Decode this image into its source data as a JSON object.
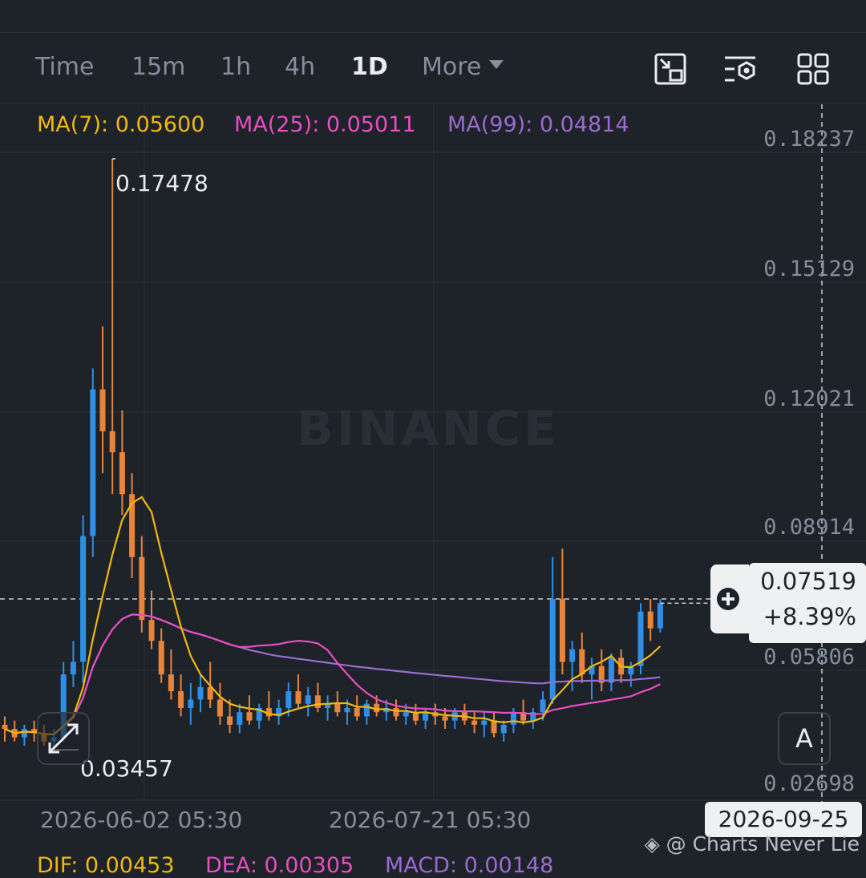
{
  "tabs": [
    {
      "label": "Time",
      "active": false
    },
    {
      "label": "15m",
      "active": false
    },
    {
      "label": "1h",
      "active": false
    },
    {
      "label": "4h",
      "active": false
    },
    {
      "label": "1D",
      "active": true
    },
    {
      "label": "More",
      "active": false
    }
  ],
  "toolbar": {
    "icons": [
      "fullscreen-icon",
      "indicator-settings-icon",
      "layout-grid-icon"
    ]
  },
  "ma": {
    "ma7": {
      "label": "MA(7): 0.05600",
      "color": "#f0b90b"
    },
    "ma25": {
      "label": "MA(25): 0.05011",
      "color": "#e84ec1"
    },
    "ma99": {
      "label": "MA(99): 0.04814",
      "color": "#9b6bd1"
    }
  },
  "y_axis": [
    "0.18237",
    "0.15129",
    "0.12021",
    "0.08914",
    "0.05806",
    "0.02698"
  ],
  "x_axis": [
    "2026-06-02 05:30",
    "2026-07-21 05:30"
  ],
  "high_label": "0.17478",
  "low_label": "0.03457",
  "price_box": {
    "price": "0.07519",
    "change": "+8.39%"
  },
  "crosshair_date": "2026-09-25",
  "auto_button": "A",
  "watermark": "BINANCE",
  "credit": "@ Charts Never Lie",
  "macd": {
    "dif": "DIF: 0.00453",
    "dea": "DEA: 0.00305",
    "macd": "MACD: 0.00148"
  },
  "colors": {
    "up": "#2f8fe8",
    "down": "#e8853a",
    "background": "#1e2229"
  },
  "chart_data": {
    "type": "candlestick",
    "ylim": [
      0.022,
      0.188
    ],
    "up_color": "#2f8fe8",
    "down_color": "#e8853a",
    "ohlc_start_index": 0,
    "candles": [
      [
        0.04,
        0.042,
        0.036,
        0.039
      ],
      [
        0.039,
        0.041,
        0.036,
        0.037
      ],
      [
        0.037,
        0.04,
        0.035,
        0.039
      ],
      [
        0.039,
        0.041,
        0.036,
        0.038
      ],
      [
        0.038,
        0.04,
        0.035,
        0.036
      ],
      [
        0.036,
        0.039,
        0.034,
        0.037
      ],
      [
        0.037,
        0.055,
        0.036,
        0.052
      ],
      [
        0.052,
        0.06,
        0.049,
        0.055
      ],
      [
        0.055,
        0.09,
        0.05,
        0.085
      ],
      [
        0.085,
        0.125,
        0.08,
        0.12
      ],
      [
        0.12,
        0.135,
        0.1,
        0.11
      ],
      [
        0.11,
        0.175,
        0.095,
        0.105
      ],
      [
        0.105,
        0.115,
        0.09,
        0.095
      ],
      [
        0.095,
        0.1,
        0.075,
        0.08
      ],
      [
        0.08,
        0.085,
        0.062,
        0.065
      ],
      [
        0.065,
        0.072,
        0.058,
        0.06
      ],
      [
        0.06,
        0.063,
        0.05,
        0.052
      ],
      [
        0.052,
        0.058,
        0.046,
        0.048
      ],
      [
        0.048,
        0.052,
        0.042,
        0.044
      ],
      [
        0.044,
        0.05,
        0.04,
        0.046
      ],
      [
        0.046,
        0.052,
        0.043,
        0.049
      ],
      [
        0.049,
        0.055,
        0.044,
        0.046
      ],
      [
        0.046,
        0.05,
        0.04,
        0.042
      ],
      [
        0.042,
        0.046,
        0.038,
        0.04
      ],
      [
        0.04,
        0.045,
        0.038,
        0.043
      ],
      [
        0.043,
        0.047,
        0.04,
        0.041
      ],
      [
        0.041,
        0.045,
        0.039,
        0.044
      ],
      [
        0.044,
        0.048,
        0.041,
        0.042
      ],
      [
        0.042,
        0.046,
        0.04,
        0.044
      ],
      [
        0.044,
        0.05,
        0.042,
        0.048
      ],
      [
        0.048,
        0.052,
        0.044,
        0.045
      ],
      [
        0.045,
        0.049,
        0.042,
        0.047
      ],
      [
        0.047,
        0.05,
        0.043,
        0.044
      ],
      [
        0.044,
        0.047,
        0.041,
        0.045
      ],
      [
        0.045,
        0.048,
        0.042,
        0.043
      ],
      [
        0.043,
        0.046,
        0.04,
        0.044
      ],
      [
        0.044,
        0.047,
        0.041,
        0.042
      ],
      [
        0.042,
        0.046,
        0.04,
        0.045
      ],
      [
        0.045,
        0.047,
        0.042,
        0.043
      ],
      [
        0.043,
        0.046,
        0.041,
        0.044
      ],
      [
        0.044,
        0.046,
        0.041,
        0.042
      ],
      [
        0.042,
        0.045,
        0.04,
        0.043
      ],
      [
        0.043,
        0.045,
        0.04,
        0.041
      ],
      [
        0.041,
        0.044,
        0.039,
        0.043
      ],
      [
        0.043,
        0.045,
        0.04,
        0.042
      ],
      [
        0.042,
        0.044,
        0.039,
        0.041
      ],
      [
        0.041,
        0.044,
        0.039,
        0.043
      ],
      [
        0.043,
        0.045,
        0.04,
        0.041
      ],
      [
        0.041,
        0.043,
        0.038,
        0.04
      ],
      [
        0.04,
        0.043,
        0.037,
        0.041
      ],
      [
        0.041,
        0.043,
        0.037,
        0.038
      ],
      [
        0.038,
        0.041,
        0.036,
        0.04
      ],
      [
        0.04,
        0.044,
        0.038,
        0.043
      ],
      [
        0.043,
        0.046,
        0.04,
        0.041
      ],
      [
        0.041,
        0.044,
        0.039,
        0.043
      ],
      [
        0.043,
        0.048,
        0.041,
        0.046
      ],
      [
        0.046,
        0.08,
        0.045,
        0.07
      ],
      [
        0.07,
        0.082,
        0.052,
        0.055
      ],
      [
        0.055,
        0.06,
        0.048,
        0.058
      ],
      [
        0.058,
        0.062,
        0.05,
        0.052
      ],
      [
        0.052,
        0.056,
        0.046,
        0.054
      ],
      [
        0.054,
        0.058,
        0.048,
        0.05
      ],
      [
        0.05,
        0.057,
        0.048,
        0.056
      ],
      [
        0.056,
        0.058,
        0.05,
        0.052
      ],
      [
        0.052,
        0.055,
        0.049,
        0.054
      ],
      [
        0.054,
        0.069,
        0.052,
        0.067
      ],
      [
        0.067,
        0.07,
        0.06,
        0.063
      ],
      [
        0.063,
        0.07,
        0.062,
        0.069
      ]
    ]
  }
}
